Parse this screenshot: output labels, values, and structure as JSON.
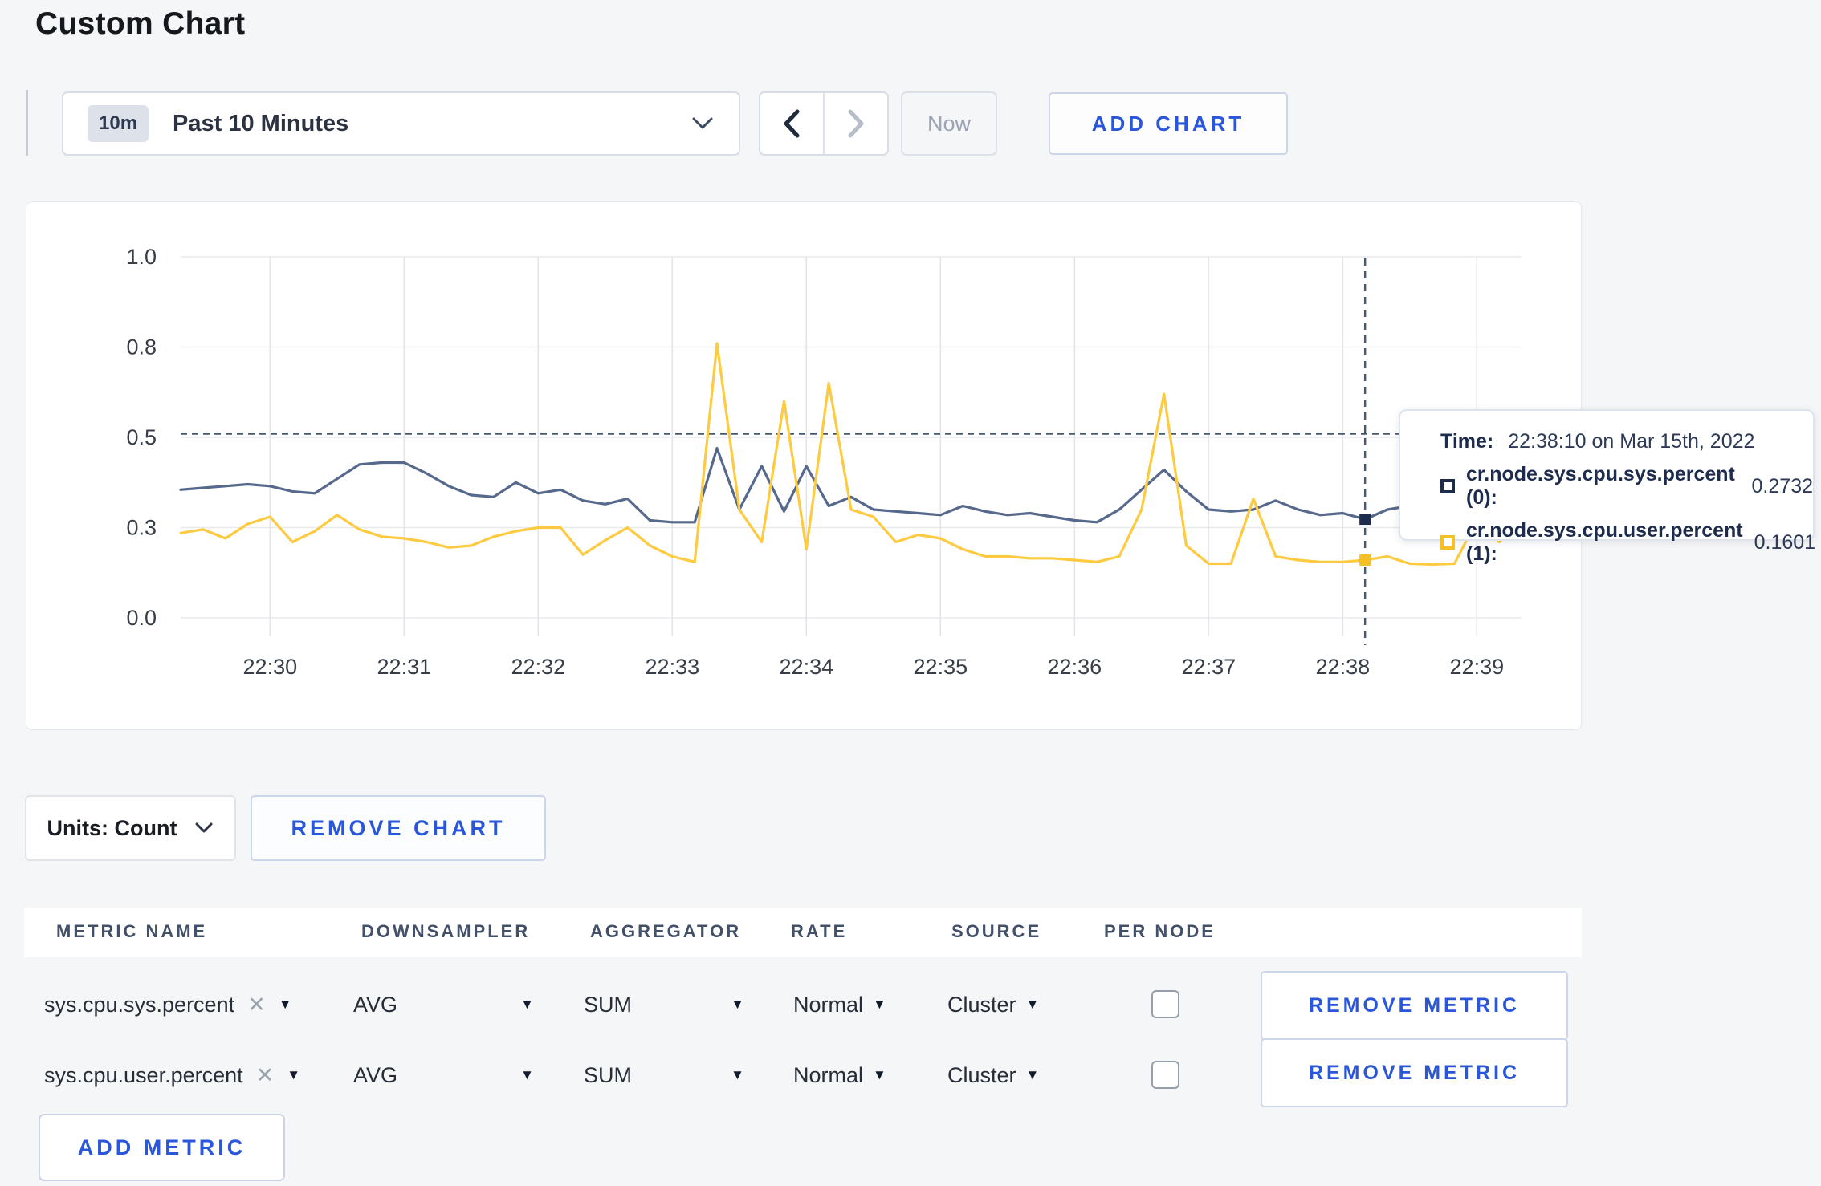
{
  "colors": {
    "accent": "#2a56d9",
    "page_background": "#f5f6f8",
    "sys_line": "#56688c",
    "sys_swatch": "#1d2b4d",
    "user_line": "#fdca40",
    "user_swatch": "#f5bf26"
  },
  "icons": {
    "dropdown_arrow": "▼",
    "remove_x": "✕"
  },
  "page": {
    "title": "Custom Chart"
  },
  "toolbar": {
    "time_range": {
      "badge": "10m",
      "label": "Past 10 Minutes"
    },
    "now_label": "Now",
    "add_chart_label": "ADD CHART"
  },
  "chart": {
    "units_label": "Units: Count",
    "remove_chart_label": "REMOVE CHART",
    "tooltip": {
      "time_label": "Time:",
      "time_value": "22:38:10 on Mar 15th, 2022",
      "rows": [
        {
          "label": "cr.node.sys.cpu.sys.percent (0):",
          "value": "0.2732"
        },
        {
          "label": "cr.node.sys.cpu.user.percent (1):",
          "value": "0.1601"
        }
      ]
    }
  },
  "chart_data": {
    "type": "line",
    "title": "",
    "xlabel": "",
    "ylabel": "",
    "ylim": [
      0,
      1
    ],
    "grid": true,
    "legend": "tooltip",
    "x_start": "22:29:20",
    "x_end": "22:39:20",
    "step_seconds": 10,
    "x_ticks": [
      "22:30",
      "22:31",
      "22:32",
      "22:33",
      "22:34",
      "22:35",
      "22:36",
      "22:37",
      "22:38",
      "22:39"
    ],
    "y_ticks": [
      {
        "value": 0.0,
        "label": "0.0"
      },
      {
        "value": 0.25,
        "label": "0.3"
      },
      {
        "value": 0.5,
        "label": "0.5"
      },
      {
        "value": 0.75,
        "label": "0.8"
      },
      {
        "value": 1.0,
        "label": "1.0"
      }
    ],
    "series": [
      {
        "name": "cr.node.sys.cpu.sys.percent",
        "color": "#56688c",
        "swatch": "#1d2b4d",
        "values": [
          0.355,
          0.36,
          0.365,
          0.37,
          0.365,
          0.35,
          0.345,
          0.385,
          0.425,
          0.43,
          0.43,
          0.4,
          0.365,
          0.34,
          0.335,
          0.375,
          0.345,
          0.355,
          0.325,
          0.315,
          0.33,
          0.27,
          0.265,
          0.265,
          0.47,
          0.3,
          0.42,
          0.295,
          0.42,
          0.31,
          0.335,
          0.3,
          0.295,
          0.29,
          0.285,
          0.31,
          0.295,
          0.285,
          0.29,
          0.28,
          0.27,
          0.265,
          0.3,
          0.355,
          0.41,
          0.35,
          0.3,
          0.295,
          0.3,
          0.325,
          0.3,
          0.285,
          0.29,
          0.2732,
          0.3,
          0.31,
          0.295,
          0.3,
          0.315,
          0.3,
          0.305
        ]
      },
      {
        "name": "cr.node.sys.cpu.user.percent",
        "color": "#fdca40",
        "swatch": "#f5bf26",
        "values": [
          0.235,
          0.245,
          0.22,
          0.26,
          0.28,
          0.21,
          0.24,
          0.285,
          0.245,
          0.225,
          0.22,
          0.21,
          0.195,
          0.2,
          0.225,
          0.24,
          0.25,
          0.25,
          0.175,
          0.215,
          0.25,
          0.2,
          0.17,
          0.155,
          0.76,
          0.3,
          0.21,
          0.6,
          0.19,
          0.65,
          0.3,
          0.28,
          0.21,
          0.23,
          0.22,
          0.19,
          0.17,
          0.17,
          0.165,
          0.165,
          0.16,
          0.155,
          0.17,
          0.3,
          0.62,
          0.2,
          0.15,
          0.15,
          0.33,
          0.17,
          0.16,
          0.155,
          0.155,
          0.1601,
          0.17,
          0.15,
          0.148,
          0.15,
          0.27,
          0.21,
          0.27
        ]
      }
    ],
    "cursor": {
      "time": "22:38:10",
      "value_line": 0.51,
      "points": [
        0.2732,
        0.1601
      ]
    }
  },
  "metrics_table": {
    "columns": [
      "METRIC NAME",
      "DOWNSAMPLER",
      "AGGREGATOR",
      "RATE",
      "SOURCE",
      "PER NODE"
    ],
    "rows": [
      {
        "metric": "sys.cpu.sys.percent",
        "downsampler": "AVG",
        "aggregator": "SUM",
        "rate": "Normal",
        "source": "Cluster",
        "per_node": false
      },
      {
        "metric": "sys.cpu.user.percent",
        "downsampler": "AVG",
        "aggregator": "SUM",
        "rate": "Normal",
        "source": "Cluster",
        "per_node": false
      }
    ],
    "remove_metric_label": "REMOVE METRIC",
    "add_metric_label": "ADD METRIC"
  }
}
